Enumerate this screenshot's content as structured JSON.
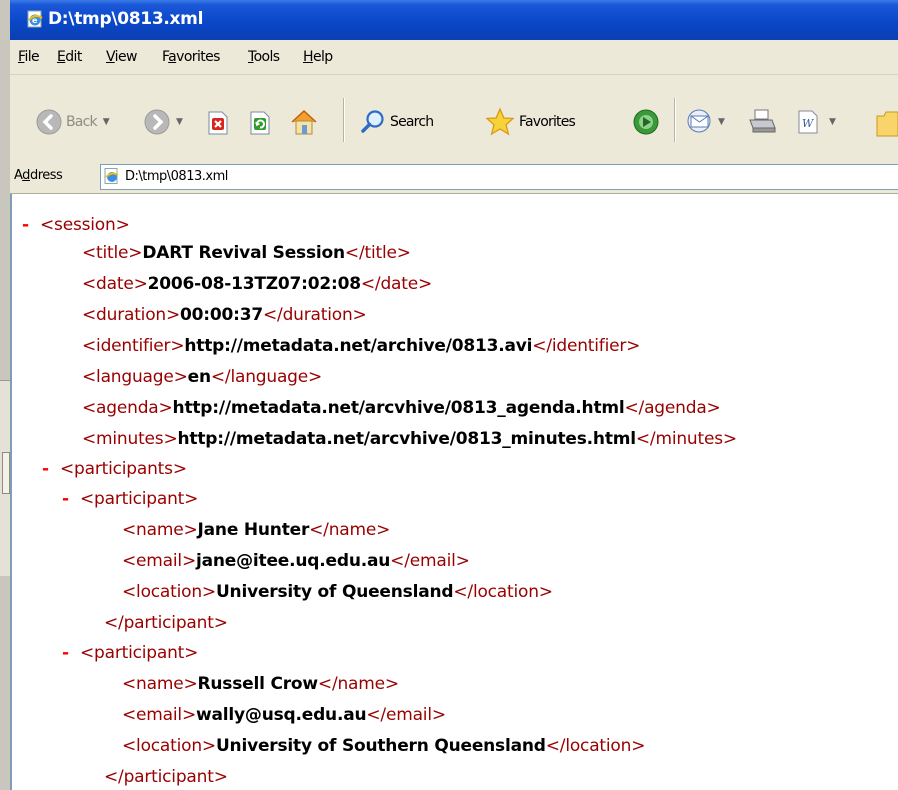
{
  "window": {
    "title": "D:\\tmp\\0813.xml"
  },
  "menu": [
    "File",
    "Edit",
    "View",
    "Favorites",
    "Tools",
    "Help"
  ],
  "menu_accel": [
    "F",
    "E",
    "V",
    "a",
    "T",
    "H"
  ],
  "toolbar": {
    "back": "Back",
    "search": "Search",
    "favorites": "Favorites"
  },
  "address": {
    "label": "Address",
    "label_accel": "d",
    "url": "D:\\tmp\\0813.xml"
  },
  "xml": {
    "session": "session",
    "title_tag": "title",
    "title": "DART Revival Session",
    "date_tag": "date",
    "date": "2006-08-13TZ07:02:08",
    "duration_tag": "duration",
    "duration": "00:00:37",
    "identifier_tag": "identifier",
    "identifier": "http://metadata.net/archive/0813.avi",
    "language_tag": "language",
    "language": "en",
    "agenda_tag": "agenda",
    "agenda": "http://metadata.net/arcvhive/0813_agenda.html",
    "minutes_tag": "minutes",
    "minutes": "http://metadata.net/arcvhive/0813_minutes.html",
    "participants": "participants",
    "participant": "participant",
    "name_tag": "name",
    "email_tag": "email",
    "location_tag": "location",
    "p1": {
      "name": "Jane Hunter",
      "email": "jane@itee.uq.edu.au",
      "location": "University of Queensland"
    },
    "p2": {
      "name": "Russell Crow",
      "email": "wally@usq.edu.au",
      "location": "University of Southern Queensland"
    },
    "toggle": "-"
  }
}
